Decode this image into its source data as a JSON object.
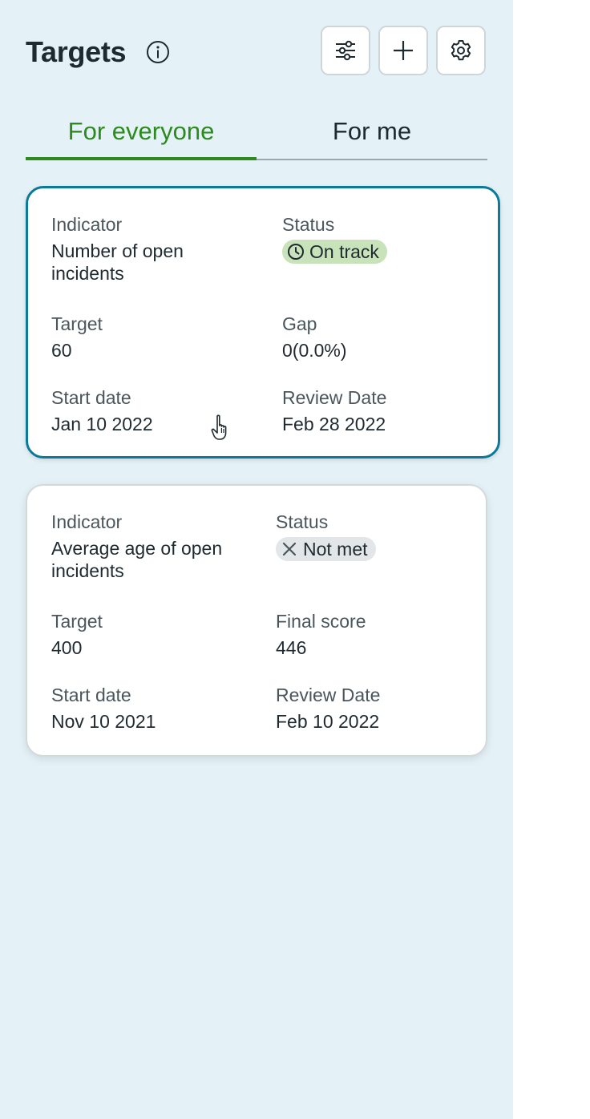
{
  "header": {
    "title": "Targets",
    "info_icon": "info-icon",
    "buttons": [
      {
        "icon": "filter-sliders-icon"
      },
      {
        "icon": "plus-icon"
      },
      {
        "icon": "gear-icon"
      }
    ]
  },
  "tabs": [
    {
      "label": "For everyone",
      "selected": true
    },
    {
      "label": "For me",
      "selected": false
    }
  ],
  "colors": {
    "panel_bg": "#e4f1f7",
    "accent_green": "#2d8a1e",
    "selected_border": "#0b7a99",
    "on_track_bg": "#c8e2b9",
    "not_met_bg": "#e2e6e8"
  },
  "cards": [
    {
      "indicator_label": "Indicator",
      "indicator_value": "Number of open incidents",
      "status_label": "Status",
      "status_value": "On track",
      "status_icon": "clock-icon",
      "target_label": "Target",
      "target_value": "60",
      "metric_label": "Gap",
      "metric_value": "0(0.0%)",
      "start_label": "Start date",
      "start_value": "Jan 10 2022",
      "review_label": "Review Date",
      "review_value": "Feb 28 2022"
    },
    {
      "indicator_label": "Indicator",
      "indicator_value": "Average age of open incidents",
      "status_label": "Status",
      "status_value": "Not met",
      "status_icon": "x-icon",
      "target_label": "Target",
      "target_value": "400",
      "metric_label": "Final score",
      "metric_value": "446",
      "start_label": "Start date",
      "start_value": "Nov 10 2021",
      "review_label": "Review Date",
      "review_value": "Feb 10 2022"
    }
  ]
}
